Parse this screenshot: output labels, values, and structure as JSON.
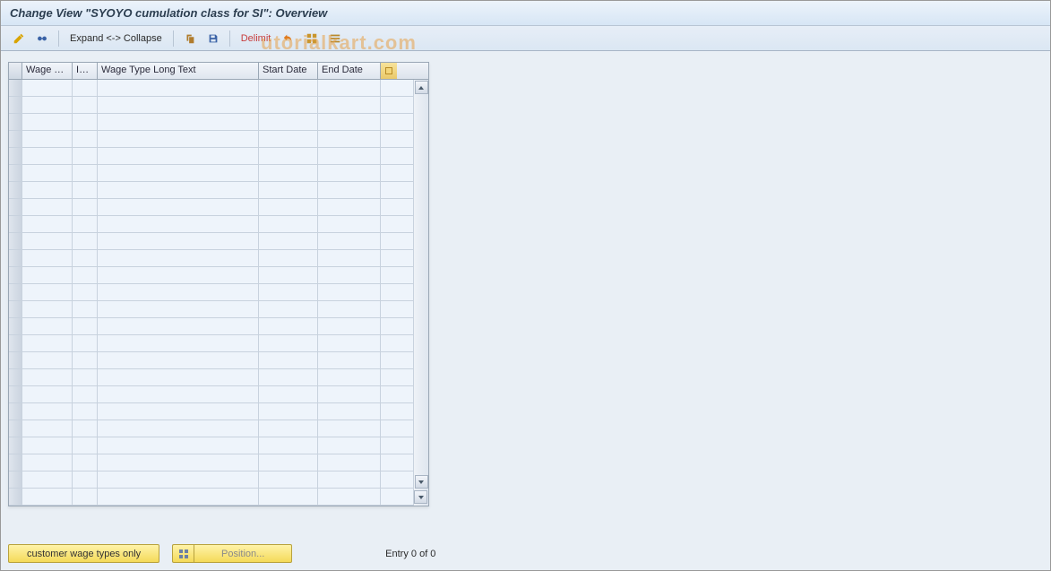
{
  "title": "Change View \"SYOYO cumulation class for SI\": Overview",
  "watermark": "utorialkart.com",
  "toolbar": {
    "expand_collapse": "Expand <-> Collapse",
    "delimit": "Delimit"
  },
  "table": {
    "columns": {
      "c1": "Wage Ty...",
      "c2": "Inf...",
      "c3": "Wage Type Long Text",
      "c4": "Start Date",
      "c5": "End Date"
    },
    "row_count": 25
  },
  "footer": {
    "customer_btn": "customer wage types only",
    "position_btn": "Position...",
    "entry_text": "Entry 0 of 0"
  }
}
